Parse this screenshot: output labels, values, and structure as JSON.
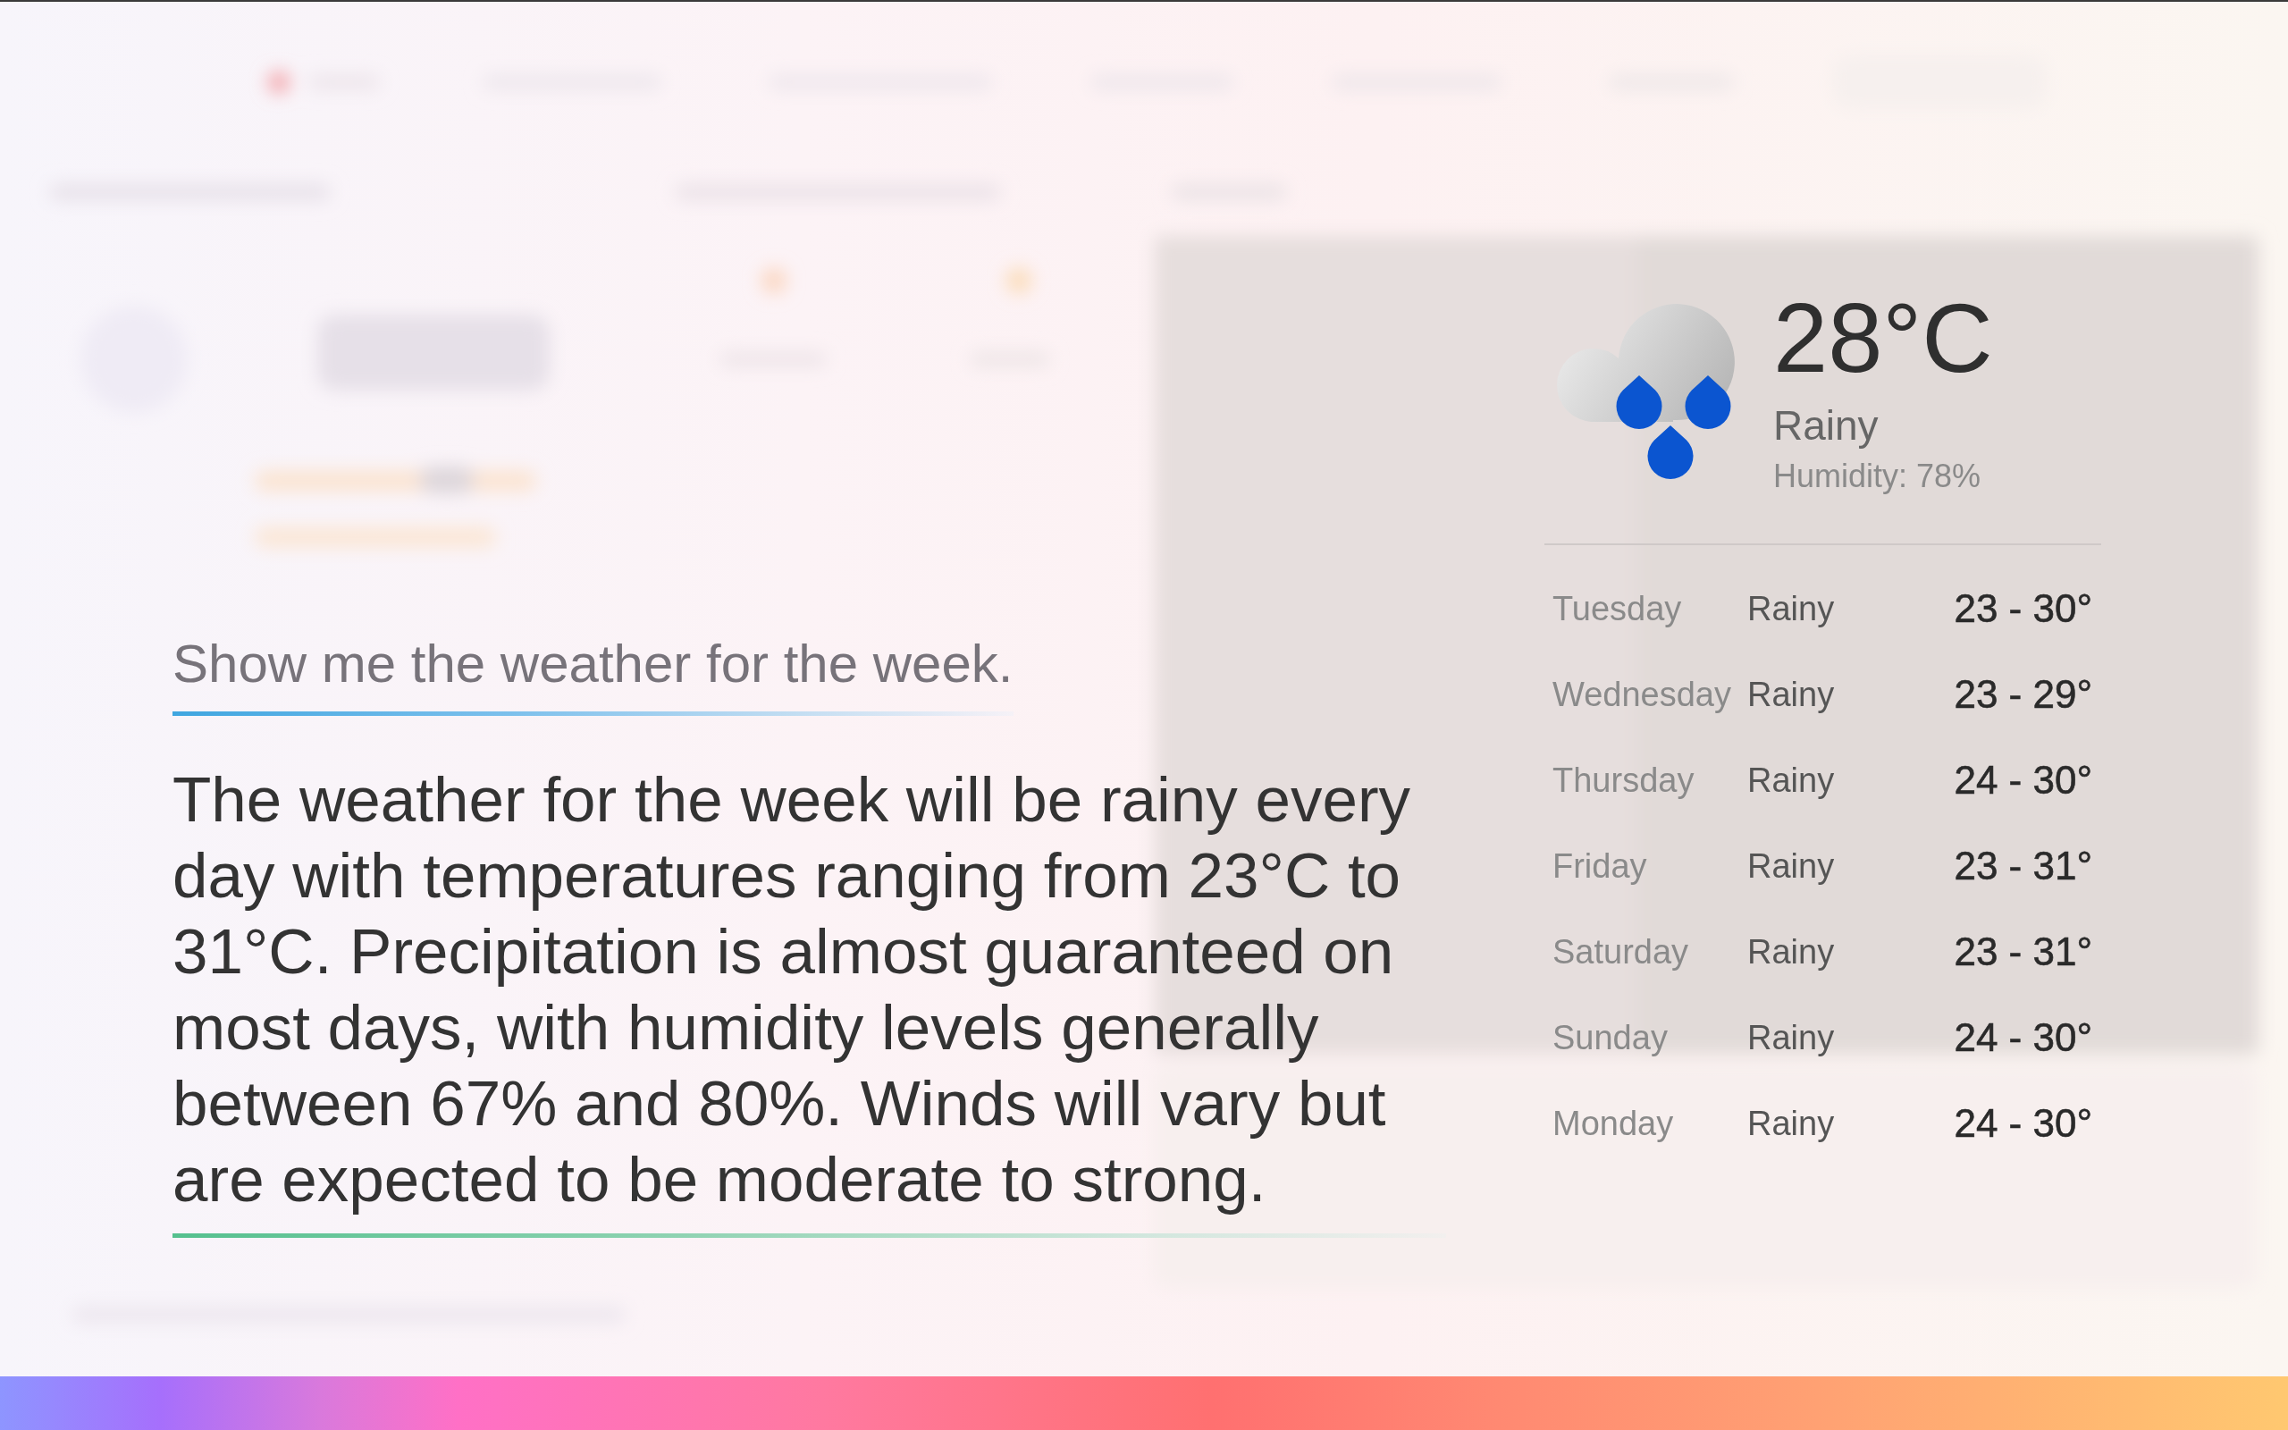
{
  "query": {
    "text": "Show me the weather for the week."
  },
  "answer": {
    "text": "The weather for the week will be rainy every day with temperatures ranging from 23°C to 31°C. Precipitation is almost guaranteed on most days, with humidity levels generally between 67% and 80%. Winds will vary but are expected to be moderate to strong."
  },
  "current": {
    "temperature": "28°C",
    "condition": "Rainy",
    "humidity": "Humidity: 78%"
  },
  "forecast": [
    {
      "day": "Tuesday",
      "condition": "Rainy",
      "range": "23 - 30°"
    },
    {
      "day": "Wednesday",
      "condition": "Rainy",
      "range": "23 - 29°"
    },
    {
      "day": "Thursday",
      "condition": "Rainy",
      "range": "24 - 30°"
    },
    {
      "day": "Friday",
      "condition": "Rainy",
      "range": "23 - 31°"
    },
    {
      "day": "Saturday",
      "condition": "Rainy",
      "range": "23 - 31°"
    },
    {
      "day": "Sunday",
      "condition": "Rainy",
      "range": "24 - 30°"
    },
    {
      "day": "Monday",
      "condition": "Rainy",
      "range": "24 - 30°"
    }
  ]
}
